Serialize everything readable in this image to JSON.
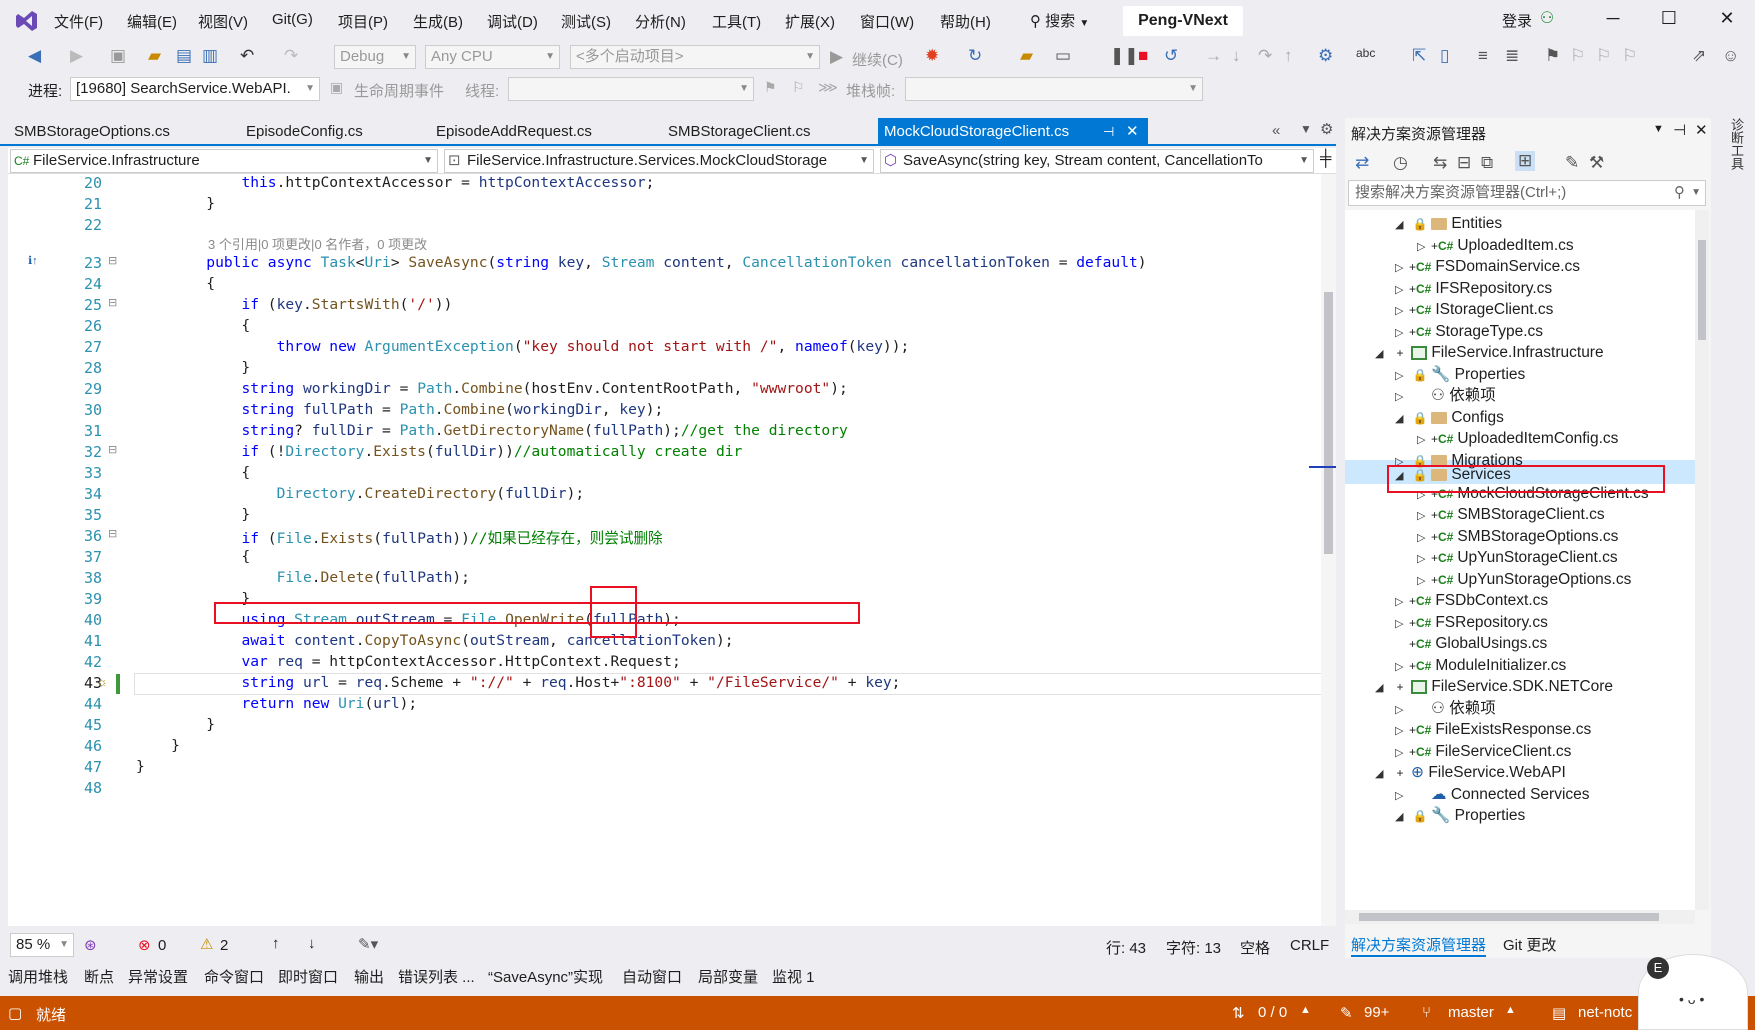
{
  "menu": {
    "items": [
      "文件(F)",
      "编辑(E)",
      "视图(V)",
      "Git(G)",
      "项目(P)",
      "生成(B)",
      "调试(D)",
      "测试(S)",
      "分析(N)",
      "工具(T)",
      "扩展(X)",
      "窗口(W)",
      "帮助(H)"
    ],
    "search_label": "搜索",
    "solution_name": "Peng-VNext",
    "login_label": "登录"
  },
  "toolbar": {
    "config": "Debug",
    "platform": "Any CPU",
    "startup": "<多个启动项目>",
    "continue_label": "继续(C)",
    "process_label": "进程:",
    "process_value": "[19680] SearchService.WebAPI.",
    "lifecycle_label": "生命周期事件",
    "thread_label": "线程:",
    "stackframe_label": "堆栈帧:"
  },
  "tabs": [
    {
      "label": "SMBStorageOptions.cs",
      "active": false
    },
    {
      "label": "EpisodeConfig.cs",
      "active": false
    },
    {
      "label": "EpisodeAddRequest.cs",
      "active": false
    },
    {
      "label": "SMBStorageClient.cs",
      "active": false
    },
    {
      "label": "MockCloudStorageClient.cs",
      "active": true
    }
  ],
  "navbar": {
    "project": "FileService.Infrastructure",
    "type": "FileService.Infrastructure.Services.MockCloudStorage",
    "member": "SaveAsync(string key, Stream content, CancellationTo"
  },
  "editor": {
    "codelens": "3 个引用|0 项更改|0 名作者，0 项更改",
    "line_numbers": [
      "20",
      "21",
      "22",
      "23",
      "24",
      "25",
      "26",
      "27",
      "28",
      "29",
      "30",
      "31",
      "32",
      "33",
      "34",
      "35",
      "36",
      "37",
      "38",
      "39",
      "40",
      "41",
      "42",
      "43",
      "44",
      "45",
      "46",
      "47",
      "48"
    ]
  },
  "editstatus": {
    "zoom": "85 %",
    "errors": "0",
    "warnings": "2",
    "line": "行: 43",
    "char": "字符: 13",
    "spacing": "空格",
    "eol": "CRLF"
  },
  "solution_explorer": {
    "title": "解决方案资源管理器",
    "search_placeholder": "搜索解决方案资源管理器(Ctrl+;)",
    "nodes": [
      {
        "label": "Entities",
        "kind": "folder"
      },
      {
        "label": "UploadedItem.cs",
        "kind": "cs"
      },
      {
        "label": "FSDomainService.cs",
        "kind": "cs"
      },
      {
        "label": "IFSRepository.cs",
        "kind": "cs"
      },
      {
        "label": "IStorageClient.cs",
        "kind": "cs"
      },
      {
        "label": "StorageType.cs",
        "kind": "cs"
      },
      {
        "label": "FileService.Infrastructure",
        "kind": "project"
      },
      {
        "label": "Properties",
        "kind": "props"
      },
      {
        "label": "依赖项",
        "kind": "deps"
      },
      {
        "label": "Configs",
        "kind": "folder"
      },
      {
        "label": "UploadedItemConfig.cs",
        "kind": "cs"
      },
      {
        "label": "Migrations",
        "kind": "folder"
      },
      {
        "label": "Services",
        "kind": "folder"
      },
      {
        "label": "MockCloudStorageClient.cs",
        "kind": "cs"
      },
      {
        "label": "SMBStorageClient.cs",
        "kind": "cs"
      },
      {
        "label": "SMBStorageOptions.cs",
        "kind": "cs"
      },
      {
        "label": "UpYunStorageClient.cs",
        "kind": "cs"
      },
      {
        "label": "UpYunStorageOptions.cs",
        "kind": "cs"
      },
      {
        "label": "FSDbContext.cs",
        "kind": "cs"
      },
      {
        "label": "FSRepository.cs",
        "kind": "cs"
      },
      {
        "label": "GlobalUsings.cs",
        "kind": "cs"
      },
      {
        "label": "ModuleInitializer.cs",
        "kind": "cs"
      },
      {
        "label": "FileService.SDK.NETCore",
        "kind": "project"
      },
      {
        "label": "依赖项",
        "kind": "deps"
      },
      {
        "label": "FileExistsResponse.cs",
        "kind": "cs"
      },
      {
        "label": "FileServiceClient.cs",
        "kind": "cs"
      },
      {
        "label": "FileService.WebAPI",
        "kind": "web"
      },
      {
        "label": "Connected Services",
        "kind": "conn"
      },
      {
        "label": "Properties",
        "kind": "props"
      }
    ],
    "tab_active": "解决方案资源管理器",
    "tab_git": "Git 更改",
    "side_tab": "诊断工具"
  },
  "bottom_tabs": [
    "调用堆栈",
    "断点",
    "异常设置",
    "命令窗口",
    "即时窗口",
    "输出",
    "错误列表 ...",
    "“SaveAsync”实现",
    "自动窗口",
    "局部变量",
    "监视 1"
  ],
  "statusbar": {
    "ready": "就绪",
    "sync": "0 / 0",
    "changes": "99+",
    "branch": "master",
    "repo": "net-notc"
  },
  "colors": {
    "accent": "#0078d4",
    "status_bar": "#ca5100",
    "highlight_box": "#e81123"
  }
}
